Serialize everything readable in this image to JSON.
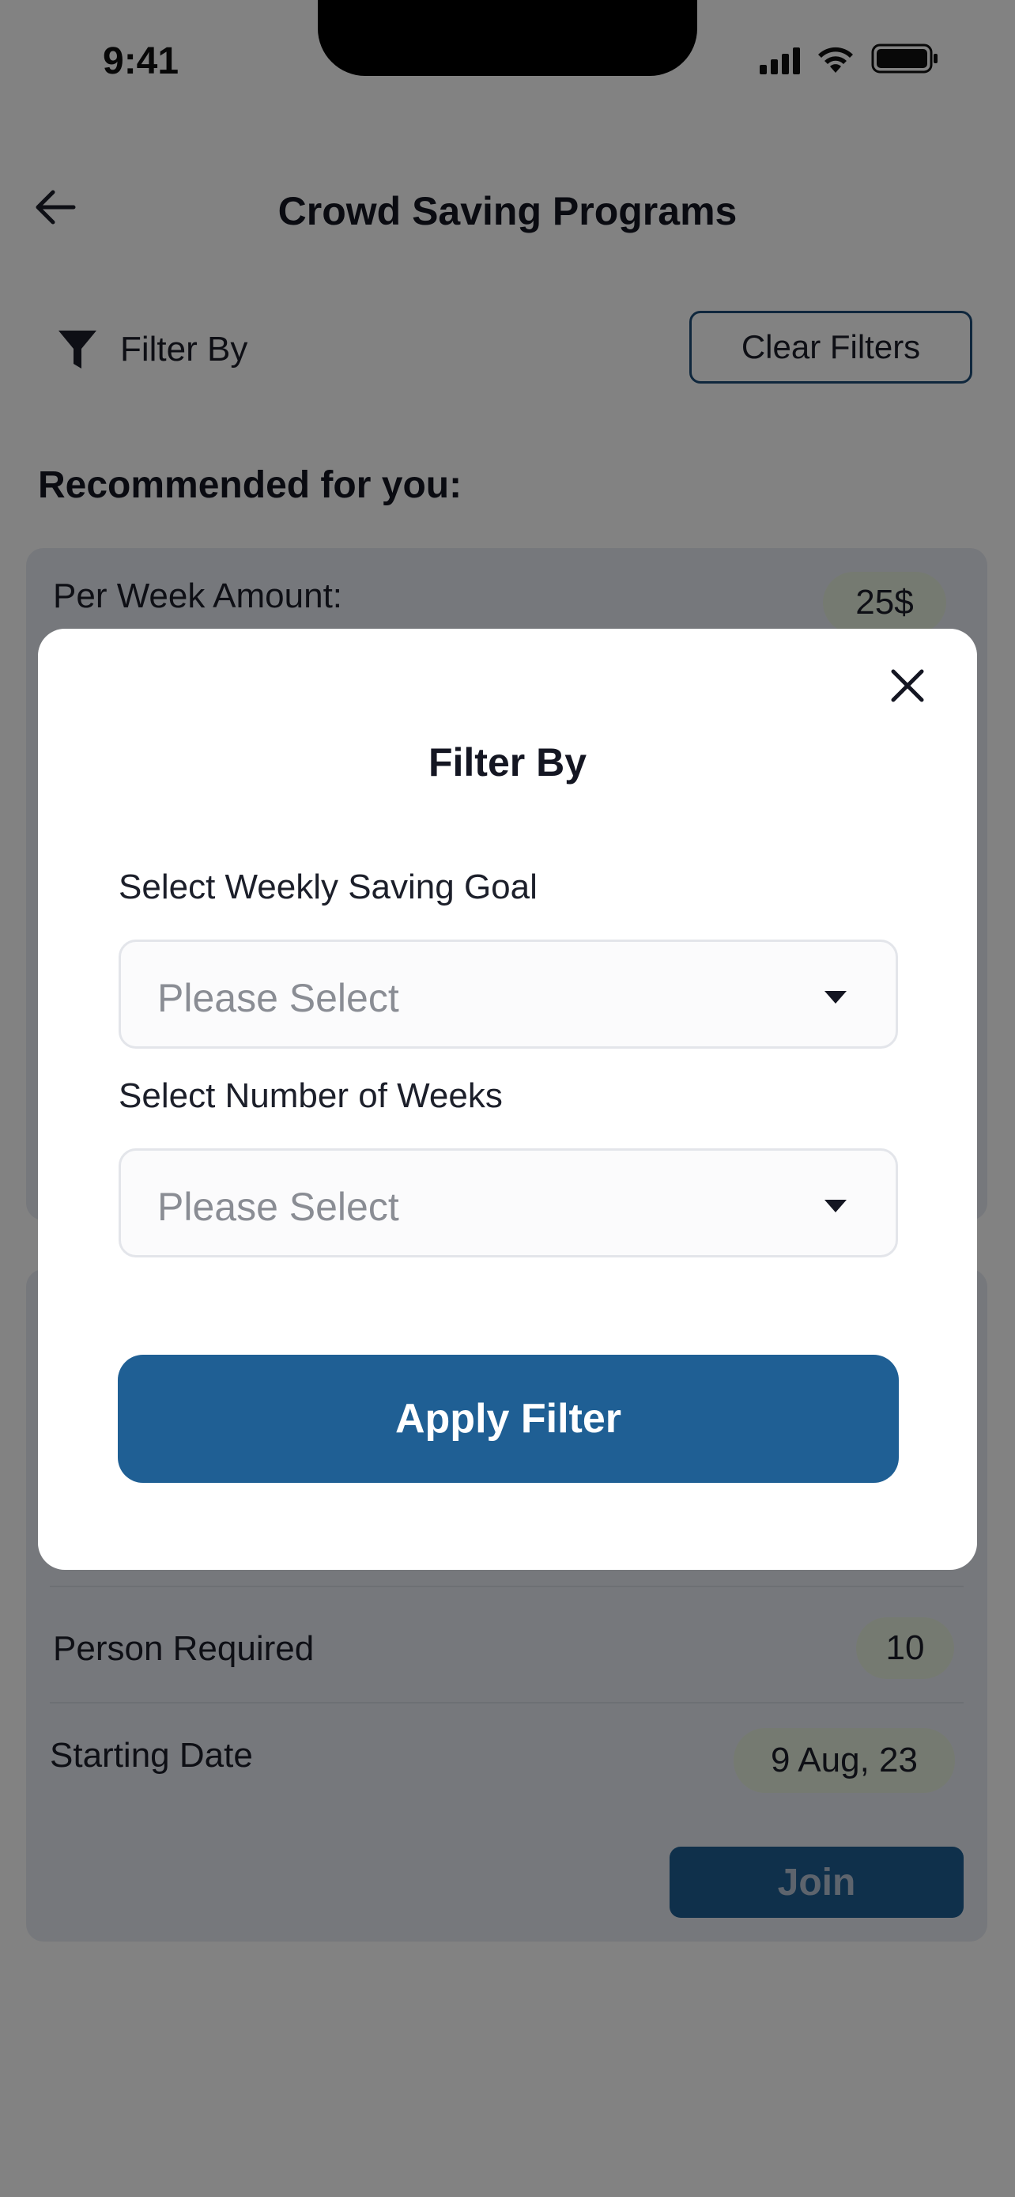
{
  "status_bar": {
    "time": "9:41",
    "icons": [
      "cellular-signal-icon",
      "wifi-icon",
      "battery-icon"
    ]
  },
  "header": {
    "back_icon": "arrow-left-icon",
    "title": "Crowd Saving Programs"
  },
  "filter_bar": {
    "filter_icon": "funnel-icon",
    "filter_label": "Filter By",
    "clear_label": "Clear Filters"
  },
  "section_heading": "Recommended for you:",
  "cards": [
    {
      "per_week_label": "Per Week Amount:",
      "per_week_value": "25$"
    },
    {
      "person_required_label": "Person Required",
      "person_required_value": "10",
      "starting_date_label": "Starting Date",
      "starting_date_value": "9 Aug, 23",
      "join_label": "Join"
    }
  ],
  "modal": {
    "close_icon": "close-icon",
    "title": "Filter By",
    "fields": [
      {
        "label": "Select Weekly Saving Goal",
        "placeholder": "Please Select",
        "icon": "caret-down-icon"
      },
      {
        "label": "Select Number of Weeks",
        "placeholder": "Please Select",
        "icon": "caret-down-icon"
      }
    ],
    "apply_label": "Apply Filter"
  },
  "colors": {
    "primary": "#1f5f94",
    "pill_background": "#e6f0de",
    "card_background": "#e8ecf3",
    "overlay": "rgba(0,0,0,0.49)"
  }
}
